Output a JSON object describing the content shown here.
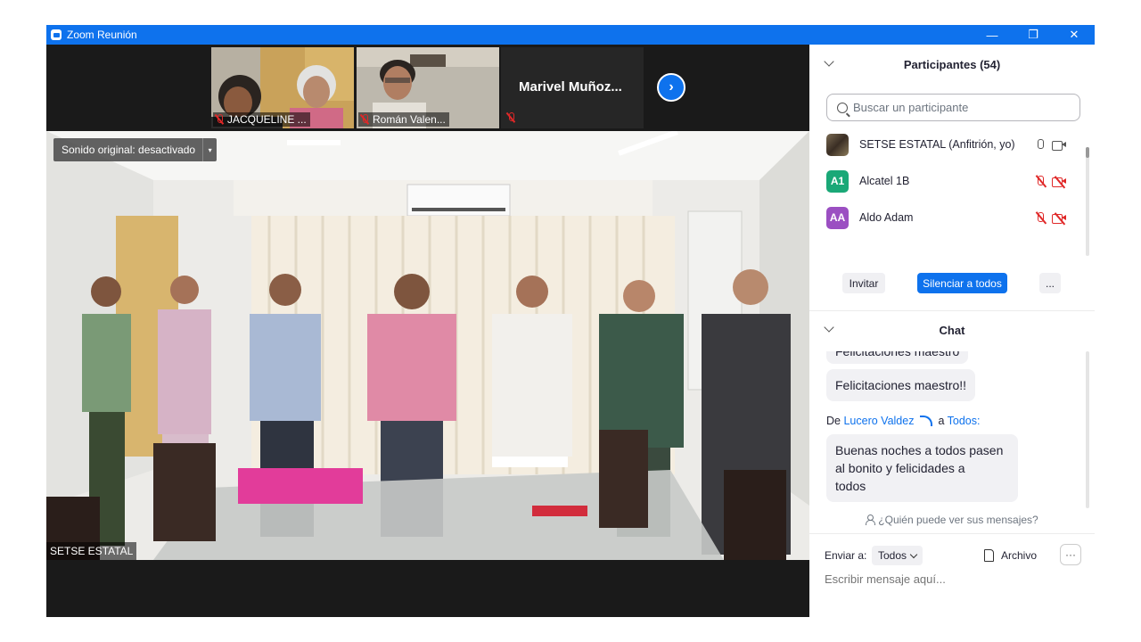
{
  "window": {
    "title": "Zoom Reunión",
    "minimize_icon": "—",
    "restore_icon": "❐",
    "close_icon": "✕"
  },
  "gallery": {
    "thumbnails": [
      {
        "name": "JACQUELINE ...",
        "muted": true
      },
      {
        "name": "Román Valen...",
        "muted": true
      },
      {
        "name": "Marivel  Muñoz...",
        "muted": true
      }
    ],
    "next_icon": "›"
  },
  "main_video": {
    "sound_label": "Sonido original: desactivado",
    "sound_caret": "▾",
    "speaker_name": "SETSE ESTATAL"
  },
  "participants": {
    "header": "Participantes (54)",
    "search_placeholder": "Buscar un participante",
    "list": [
      {
        "initials": "",
        "name": "SETSE ESTATAL (Anfitrión, yo)",
        "color": "#5a4a3a",
        "mic_muted": false,
        "video_off": false
      },
      {
        "initials": "A1",
        "name": "Alcatel 1B",
        "color": "#1aa877",
        "mic_muted": true,
        "video_off": true
      },
      {
        "initials": "AA",
        "name": "Aldo Adam",
        "color": "#9b4fc2",
        "mic_muted": true,
        "video_off": true
      }
    ],
    "invite_label": "Invitar",
    "mute_all_label": "Silenciar a todos",
    "more_label": "..."
  },
  "chat": {
    "header": "Chat",
    "partial_message": "Felicitaciones maestro",
    "messages": [
      {
        "text": "Felicitaciones maestro!!"
      }
    ],
    "sender_prefix": "De",
    "sender_name": "Lucero Valdez",
    "to_prefix": "a",
    "recipient": "Todos:",
    "last_message_lines": [
      "Buenas noches a todos pasen",
      "al bonito y felicidades a",
      "todos"
    ],
    "who_can_see": "¿Quién puede ver sus mensajes?",
    "send_to_label": "Enviar a:",
    "send_to_value": "Todos",
    "file_label": "Archivo",
    "more_label": "···",
    "input_placeholder": "Escribir mensaje aquí..."
  },
  "colors": {
    "titlebar": "#0e72ed",
    "accent": "#0e72ed",
    "muted_red": "#e02828",
    "meeting_bg": "#1a1a1a"
  }
}
